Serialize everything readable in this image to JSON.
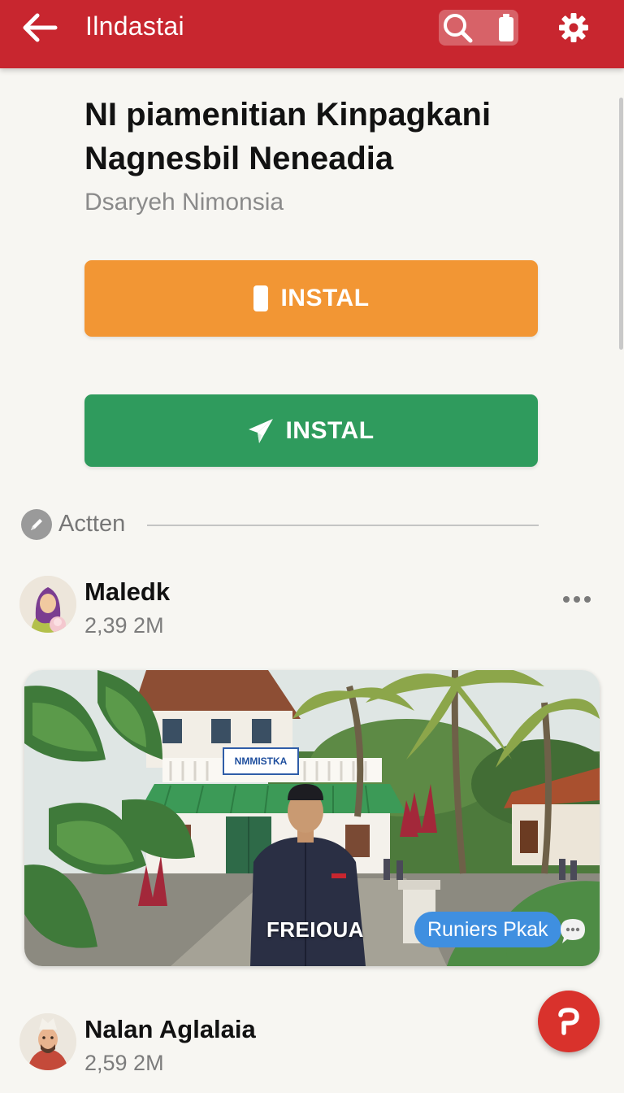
{
  "appbar": {
    "title": "Ilndastai",
    "background": "#c8262f",
    "back_icon": "arrow-left-icon",
    "search_icon": "search-icon",
    "battery_icon": "battery-icon",
    "settings_icon": "gear-icon"
  },
  "header": {
    "title": "NI piamenitian Kinpagkani Nagnesbil Neneadia",
    "subtitle": "Dsaryeh Nimonsia"
  },
  "actions": [
    {
      "label": "INSTAL",
      "icon": "phone-icon",
      "color": "#f29634"
    },
    {
      "label": "INSTAL",
      "icon": "paper-plane-icon",
      "color": "#2f9b5d"
    }
  ],
  "section": {
    "label": "Actten",
    "icon": "pencil-icon"
  },
  "posts": [
    {
      "name": "Maledk",
      "count": "2,39 2M",
      "more_icon": "more-horizontal-icon",
      "photo": {
        "sign_text": "NMMISTKA",
        "caption": "FREIOUA",
        "chip": "Runiers Pkak",
        "chip_color": "#3f8fe0",
        "comment_icon": "comment-bubble-icon"
      }
    },
    {
      "name": "Nalan Aglalaia",
      "count": "2,59 2M"
    }
  ],
  "fab": {
    "icon": "p-action-icon",
    "color": "#d9322c"
  }
}
